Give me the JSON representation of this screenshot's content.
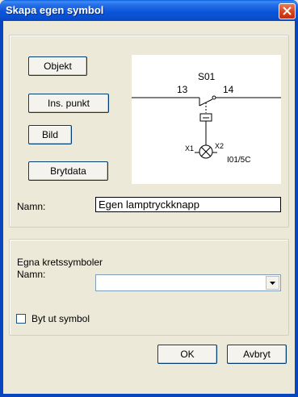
{
  "window": {
    "title": "Skapa egen symbol"
  },
  "buttons": {
    "objekt": "Objekt",
    "ins_punkt": "Ins. punkt",
    "bild": "Bild",
    "brytdata": "Brytdata",
    "ok": "OK",
    "avbryt": "Avbryt"
  },
  "symbol_preview": {
    "top_label": "S01",
    "left_terminal": "13",
    "right_terminal": "14",
    "lamp_left": "X1",
    "lamp_right": "X2",
    "lamp_ref": "I01/5C"
  },
  "name_field": {
    "label": "Namn:",
    "value": "Egen lamptryckknapp"
  },
  "circuit_group": {
    "heading": "Egna kretssymboler",
    "name_label": "Namn:",
    "selected": ""
  },
  "replace_checkbox": {
    "label": "Byt ut symbol",
    "checked": false
  }
}
